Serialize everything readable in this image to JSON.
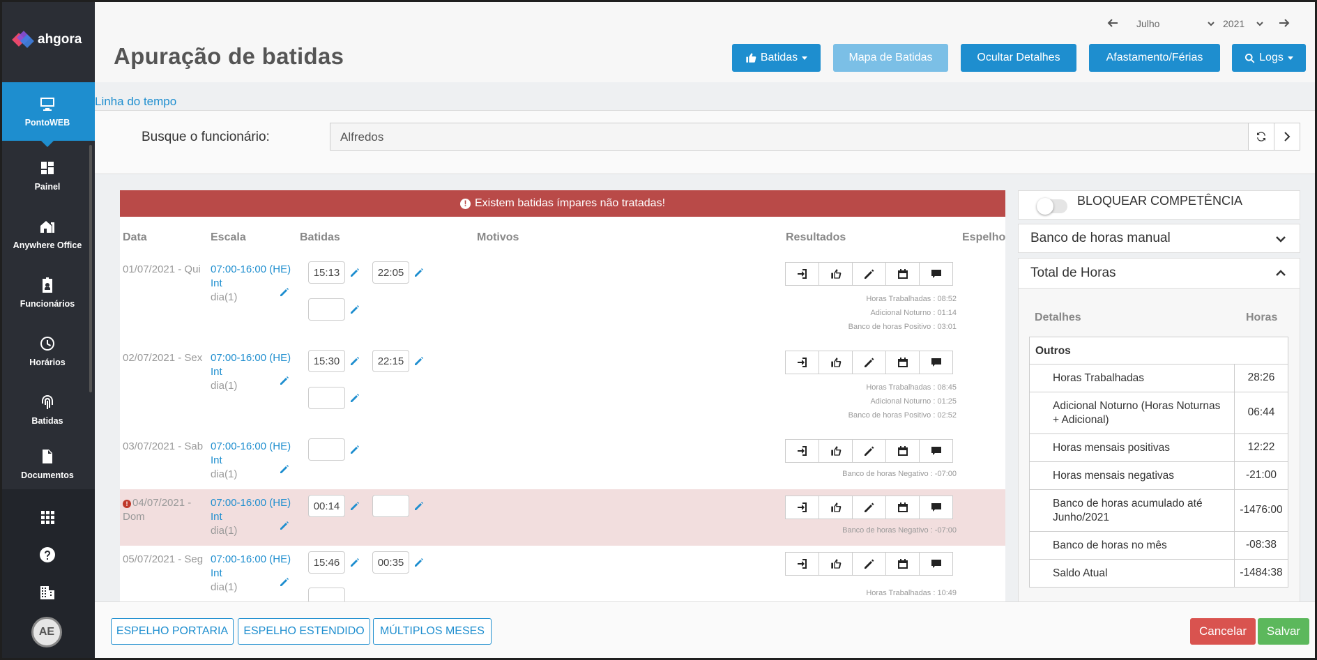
{
  "brand": {
    "name": "ahgora"
  },
  "sidebar": {
    "items": [
      {
        "label": "PontoWEB",
        "icon": "monitor-icon"
      },
      {
        "label": "Painel",
        "icon": "dashboard-icon"
      },
      {
        "label": "Anywhere Office",
        "icon": "home-office-icon"
      },
      {
        "label": "Funcionários",
        "icon": "id-badge-icon"
      },
      {
        "label": "Horários",
        "icon": "clock-icon"
      },
      {
        "label": "Batidas",
        "icon": "fingerprint-icon"
      },
      {
        "label": "Documentos",
        "icon": "document-icon"
      }
    ],
    "bottom_icons": [
      "apps-grid-icon",
      "help-icon",
      "building-icon"
    ],
    "avatar_initials": "AE"
  },
  "header": {
    "title": "Apuração de batidas",
    "period": {
      "month": "Julho",
      "year": "2021"
    },
    "buttons": {
      "batidas": "Batidas",
      "mapa": "Mapa de Batidas",
      "ocultar": "Ocultar Detalhes",
      "afastamento": "Afastamento/Férias",
      "logs": "Logs"
    }
  },
  "timeline_link": "Linha do tempo",
  "search": {
    "label": "Busque o funcionário:",
    "value": "Alfredos"
  },
  "alert": "Existem batidas ímpares não tratadas!",
  "table": {
    "headers": {
      "data": "Data",
      "escala": "Escala",
      "batidas": "Batidas",
      "motivos": "Motivos",
      "resultados": "Resultados",
      "espelho": "Espelho"
    },
    "rows": [
      {
        "date": "01/07/2021 - Qui",
        "escala1": "07:00-16:00 (HE)",
        "escala2": "Int",
        "escala3": "dia(1)",
        "b1": "15:13",
        "b2": "22:05",
        "b3": "",
        "r1": "Horas Trabalhadas : 08:52",
        "r2": "Adicional Noturno : 01:14",
        "r3": "Banco de horas Positivo : 03:01"
      },
      {
        "date": "02/07/2021 - Sex",
        "escala1": "07:00-16:00 (HE)",
        "escala2": "Int",
        "escala3": "dia(1)",
        "b1": "15:30",
        "b2": "22:15",
        "b3": "",
        "r1": "Horas Trabalhadas : 08:45",
        "r2": "Adicional Noturno : 01:25",
        "r3": "Banco de horas Positivo : 02:52"
      },
      {
        "date": "03/07/2021 - Sab",
        "escala1": "07:00-16:00 (HE)",
        "escala2": "Int",
        "escala3": "dia(1)",
        "b1": "",
        "r1": "Banco de horas Negativo : -07:00"
      },
      {
        "date1": "04/07/2021 -",
        "date2": "Dom",
        "escala1": "07:00-16:00 (HE)",
        "escala2": "Int",
        "escala3": "dia(1)",
        "b1": "00:14",
        "b2": "",
        "r1": "Banco de horas Negativo : -07:00"
      },
      {
        "date": "05/07/2021 - Seg",
        "escala1": "07:00-16:00 (HE)",
        "escala2": "Int",
        "escala3": "dia(1)",
        "b1": "15:46",
        "b2": "00:35",
        "r1": "Horas Trabalhadas : 10:49"
      }
    ]
  },
  "right_panel": {
    "bloquear": "BLOQUEAR COMPETÊNCIA",
    "banco_manual": "Banco de horas manual",
    "total_horas": "Total de Horas",
    "table_headers": {
      "detalhes": "Detalhes",
      "horas": "Horas"
    },
    "section": "Outros",
    "rows": [
      {
        "label": "Horas Trabalhadas",
        "value": "28:26"
      },
      {
        "label1": "Adicional Noturno (Horas Noturnas",
        "label2": "+ Adicional)",
        "value": "06:44"
      },
      {
        "label": "Horas mensais positivas",
        "value": "12:22"
      },
      {
        "label": "Horas mensais negativas",
        "value": "-21:00"
      },
      {
        "label1": "Banco de horas acumulado até",
        "label2": "Junho/2021",
        "value": "-1476:00"
      },
      {
        "label": "Banco de horas no mês",
        "value": "-08:38"
      },
      {
        "label": "Saldo Atual",
        "value": "-1484:38"
      }
    ]
  },
  "footer": {
    "espelho_portaria": "ESPELHO PORTARIA",
    "espelho_estendido": "ESPELHO ESTENDIDO",
    "multiplos_meses": "MÚLTIPLOS MESES",
    "cancelar": "Cancelar",
    "salvar": "Salvar"
  },
  "colors": {
    "primary": "#1e8ecf",
    "danger": "#d9534f",
    "success": "#5cb85c",
    "alert": "#b94a48",
    "sidebar": "#2b2e35"
  }
}
